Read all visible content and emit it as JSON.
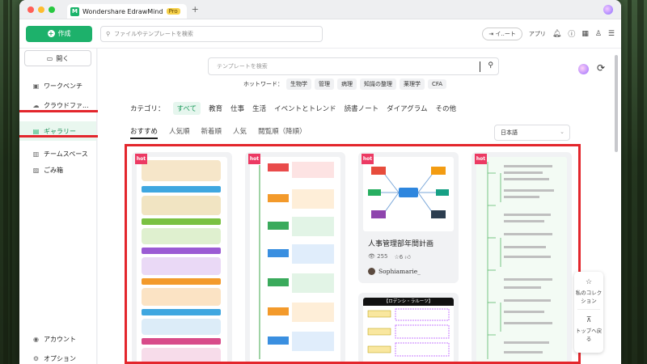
{
  "app": {
    "tab_title": "Wondershare EdrawMind",
    "badge": "Pro",
    "new_tab": "+"
  },
  "toolbar": {
    "create_label": "作成",
    "search_placeholder": "ファイルやテンプレートを検索",
    "import_label": "イ..ート",
    "apps_label": "アプリ"
  },
  "sidebar": {
    "open_label": "開く",
    "items": [
      {
        "label": "ワークベンチ",
        "icon": "workbench-icon"
      },
      {
        "label": "クラウドファ...",
        "icon": "cloud-icon"
      },
      {
        "label": "ギャラリー",
        "icon": "gallery-icon"
      },
      {
        "label": "チームスペース",
        "icon": "team-icon"
      },
      {
        "label": "ごみ箱",
        "icon": "trash-icon"
      }
    ],
    "bottom": [
      {
        "label": "アカウント",
        "icon": "account-icon"
      },
      {
        "label": "オプション",
        "icon": "options-icon"
      }
    ]
  },
  "gallery": {
    "search_placeholder": "テンプレートを検索",
    "hot_label": "ホットワード：",
    "hot_words": [
      "生物学",
      "管理",
      "病理",
      "知識の整理",
      "薬理学",
      "CFA"
    ],
    "category_label": "カテゴリ：",
    "categories": [
      "すべて",
      "教育",
      "仕事",
      "生活",
      "イベントとトレンド",
      "読書ノート",
      "ダイアグラム",
      "その他"
    ],
    "sorts": [
      "おすすめ",
      "人気順",
      "新着順",
      "人気",
      "閲覧順（降順）"
    ],
    "language": "日本語"
  },
  "cards": [
    {
      "hot": "hot"
    },
    {
      "hot": "hot"
    },
    {
      "hot": "hot",
      "title": "人事管理部年間計画",
      "views": "255",
      "stars": "6",
      "author": "Sophiamarie_"
    },
    {
      "hot": "hot"
    },
    {
      "preview_title": "【ロデンシ・ラルーツ】"
    }
  ],
  "float_panel": {
    "collect_label": "私のコレクション",
    "top_label": "トップへ戻る"
  },
  "colors": {
    "accent": "#1db16b",
    "highlight_border": "#e3262c",
    "hot_tag": "#ec3a63"
  }
}
